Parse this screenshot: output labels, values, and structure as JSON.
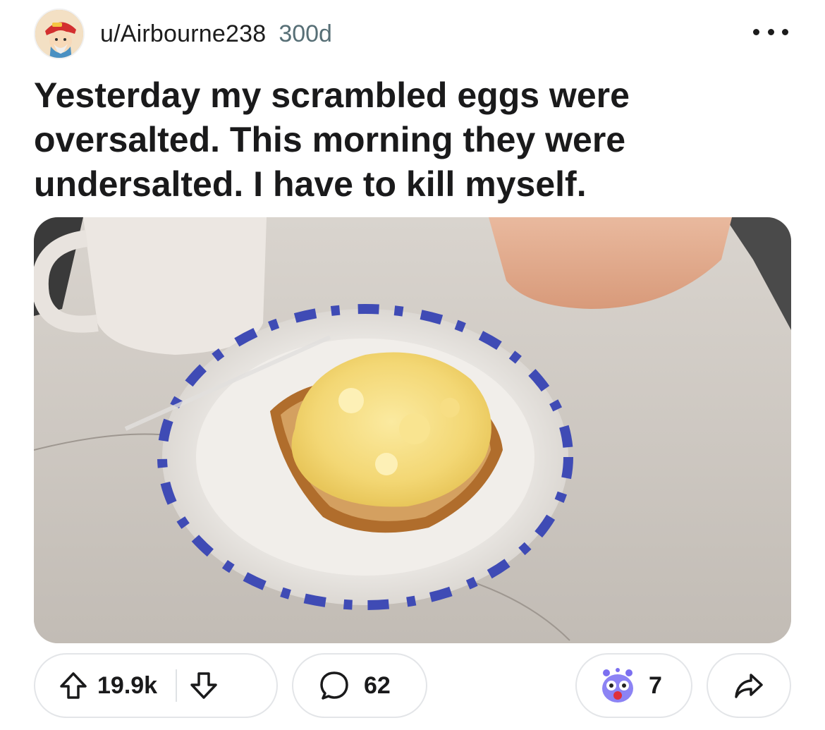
{
  "post": {
    "author": "u/Airbourne238",
    "age": "300d",
    "title": "Yesterday my scrambled eggs were oversalted. This morning they were undersalted. I have to kill myself.",
    "image_alt": "Scrambled eggs on toast on a paper plate next to a mug"
  },
  "actions": {
    "score": "19.9k",
    "comments": "62",
    "awards": "7"
  },
  "colors": {
    "text": "#1a1a1b",
    "meta": "#576f76",
    "border": "#e3e5e8"
  },
  "icons": {
    "more": "more-options-icon",
    "upvote": "upvote-arrow-icon",
    "downvote": "downvote-arrow-icon",
    "comment": "comment-bubble-icon",
    "award": "shocked-face-award-icon",
    "share": "share-arrow-icon"
  }
}
